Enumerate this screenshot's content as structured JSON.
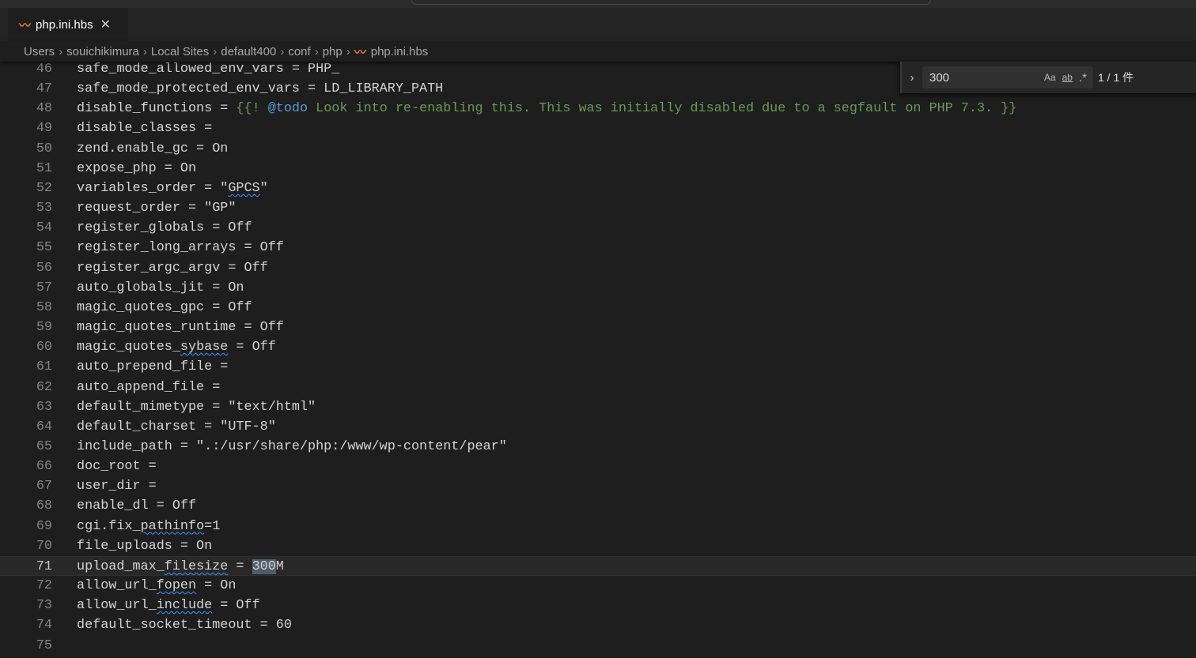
{
  "tab": {
    "title": "php.ini.hbs",
    "icon": "handlebars-icon"
  },
  "breadcrumb": [
    "Users",
    "souichikimura",
    "Local Sites",
    "default400",
    "conf",
    "php",
    "php.ini.hbs"
  ],
  "find": {
    "value": "300",
    "match_case": "Aa",
    "whole_word": "ab",
    "regex": ".*",
    "count": "1 / 1 件"
  },
  "editor": {
    "current_line": 71,
    "lines": [
      {
        "n": 46,
        "segs": [
          [
            "safe_mode_allowed_env_vars = PHP_",
            ""
          ]
        ]
      },
      {
        "n": 47,
        "segs": [
          [
            "safe_mode_protected_env_vars = LD_LIBRARY_PATH",
            ""
          ]
        ]
      },
      {
        "n": 48,
        "segs": [
          [
            "disable_functions = ",
            ""
          ],
          [
            "{{! ",
            "cm"
          ],
          [
            "@todo",
            "tag"
          ],
          [
            " Look into re-enabling this. This was initially disabled due to a segfault on PHP 7.3. }}",
            "cm"
          ]
        ]
      },
      {
        "n": 49,
        "segs": [
          [
            "disable_classes =",
            ""
          ]
        ]
      },
      {
        "n": 50,
        "segs": [
          [
            "zend.enable_gc = On",
            ""
          ]
        ]
      },
      {
        "n": 51,
        "segs": [
          [
            "expose_php = On",
            ""
          ]
        ]
      },
      {
        "n": 52,
        "segs": [
          [
            "variables_order = \"",
            ""
          ],
          [
            "GPCS",
            "sq"
          ],
          [
            "\"",
            ""
          ]
        ]
      },
      {
        "n": 53,
        "segs": [
          [
            "request_order = \"GP\"",
            ""
          ]
        ]
      },
      {
        "n": 54,
        "segs": [
          [
            "register_globals = Off",
            ""
          ]
        ]
      },
      {
        "n": 55,
        "segs": [
          [
            "register_long_arrays = Off",
            ""
          ]
        ]
      },
      {
        "n": 56,
        "segs": [
          [
            "register_argc_argv = Off",
            ""
          ]
        ]
      },
      {
        "n": 57,
        "segs": [
          [
            "auto_globals_jit = On",
            ""
          ]
        ]
      },
      {
        "n": 58,
        "segs": [
          [
            "magic_quotes_gpc = Off",
            ""
          ]
        ]
      },
      {
        "n": 59,
        "segs": [
          [
            "magic_quotes_runtime = Off",
            ""
          ]
        ]
      },
      {
        "n": 60,
        "segs": [
          [
            "magic_quotes_",
            ""
          ],
          [
            "sybase",
            "sq"
          ],
          [
            " = Off",
            ""
          ]
        ]
      },
      {
        "n": 61,
        "segs": [
          [
            "auto_prepend_file =",
            ""
          ]
        ]
      },
      {
        "n": 62,
        "segs": [
          [
            "auto_append_file =",
            ""
          ]
        ]
      },
      {
        "n": 63,
        "segs": [
          [
            "default_mimetype = \"text/html\"",
            ""
          ]
        ]
      },
      {
        "n": 64,
        "segs": [
          [
            "default_charset = \"UTF-8\"",
            ""
          ]
        ]
      },
      {
        "n": 65,
        "segs": [
          [
            "include_path = \".:/usr/share/php:/www/wp-content/pear\"",
            ""
          ]
        ]
      },
      {
        "n": 66,
        "segs": [
          [
            "doc_root =",
            ""
          ]
        ]
      },
      {
        "n": 67,
        "segs": [
          [
            "user_dir =",
            ""
          ]
        ]
      },
      {
        "n": 68,
        "segs": [
          [
            "enable_dl = Off",
            ""
          ]
        ]
      },
      {
        "n": 69,
        "segs": [
          [
            "cgi.fix_",
            ""
          ],
          [
            "pathinfo",
            "sq"
          ],
          [
            "=1",
            ""
          ]
        ]
      },
      {
        "n": 70,
        "segs": [
          [
            "file_uploads = On",
            ""
          ]
        ]
      },
      {
        "n": 71,
        "segs": [
          [
            "upload_max_",
            ""
          ],
          [
            "filesize",
            "sq"
          ],
          [
            " = ",
            ""
          ],
          [
            "300",
            "hl"
          ],
          [
            "M",
            ""
          ]
        ]
      },
      {
        "n": 72,
        "segs": [
          [
            "allow_url_",
            ""
          ],
          [
            "fopen",
            "sq"
          ],
          [
            " = On",
            ""
          ]
        ]
      },
      {
        "n": 73,
        "segs": [
          [
            "allow_url_",
            ""
          ],
          [
            "include",
            "sq"
          ],
          [
            " = Off",
            ""
          ]
        ]
      },
      {
        "n": 74,
        "segs": [
          [
            "default_socket_timeout = 60",
            ""
          ]
        ]
      },
      {
        "n": 75,
        "segs": []
      }
    ]
  }
}
